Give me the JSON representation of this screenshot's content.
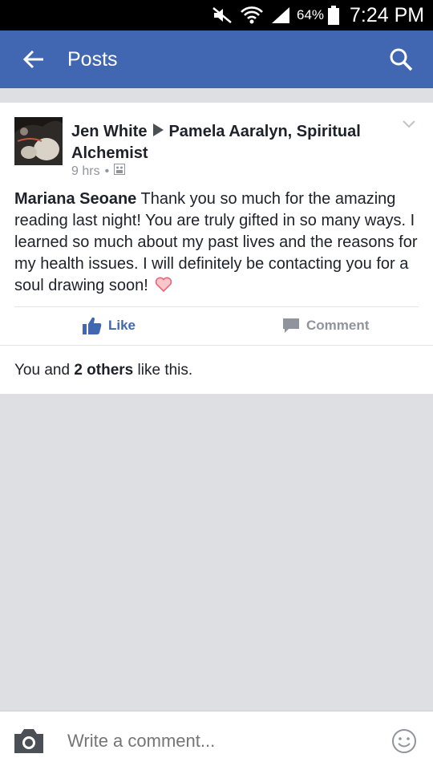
{
  "status_bar": {
    "battery_percent": "64%",
    "time": "7:24 PM"
  },
  "app_bar": {
    "title": "Posts",
    "icons": [
      "back-arrow-icon",
      "search-icon"
    ]
  },
  "post": {
    "author": "Jen White",
    "target": "Pamela Aaralyn, Spiritual Alchemist",
    "time_ago": "9 hrs",
    "commenter": "Mariana Seoane",
    "body": " Thank you so much for the amazing reading last night! You are truly gifted in so many ways. I learned so much about my past lives and the reasons for my health issues. I will definitely be contacting you for a soul drawing soon!",
    "like_label": "Like",
    "comment_label": "Comment",
    "likes_prefix": "You and ",
    "likes_count": "2 others",
    "likes_suffix": " like this."
  },
  "composer": {
    "placeholder": "Write a comment..."
  },
  "colors": {
    "brand_blue": "#4267b2",
    "feed_bg": "#dddfe2",
    "meta_gray": "#90949c"
  }
}
